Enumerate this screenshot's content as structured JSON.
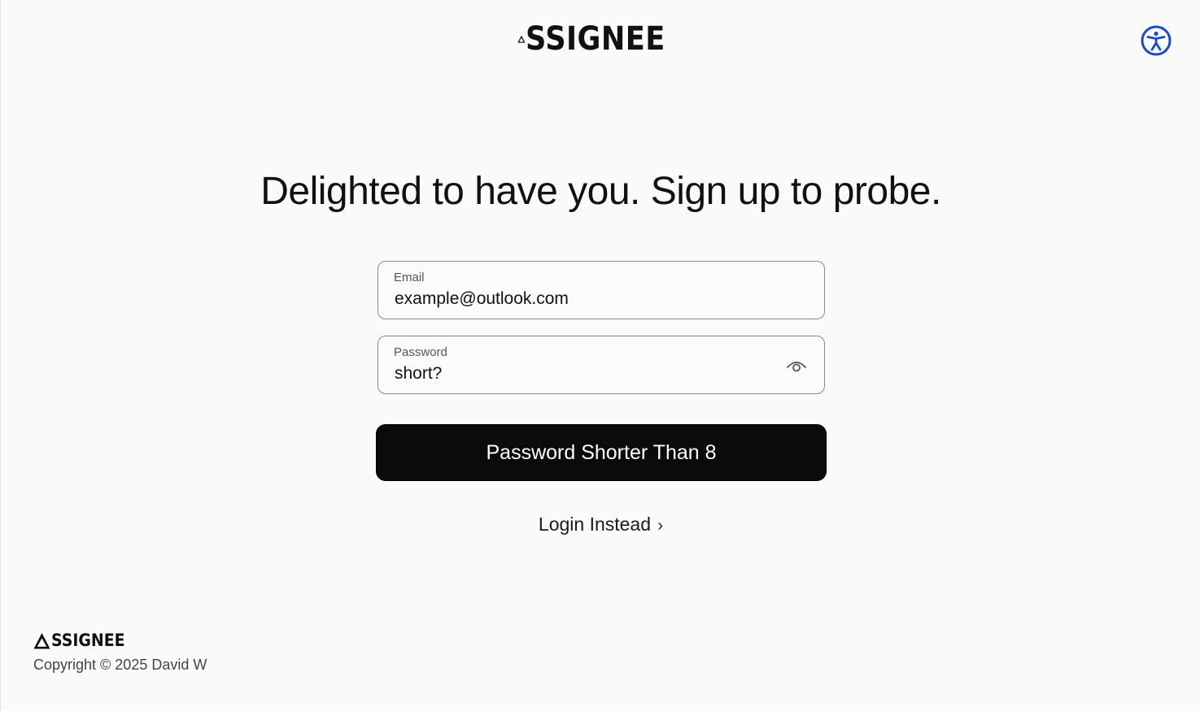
{
  "brand": {
    "name": "SSIGNEE"
  },
  "heading": "Delighted to have you. Sign up to probe.",
  "form": {
    "email": {
      "label": "Email",
      "value": "example@outlook.com"
    },
    "password": {
      "label": "Password",
      "value": "short?"
    },
    "submit_label": "Password Shorter Than 8"
  },
  "login_link": {
    "label": "Login Instead",
    "chevron": "›"
  },
  "footer": {
    "brand_name": "SSIGNEE",
    "copyright": "Copyright © 2025 David W"
  },
  "icons": {
    "logo": "triangle-a-logo-icon",
    "accessibility": "accessibility-icon",
    "password_toggle": "eye-icon"
  },
  "colors": {
    "background": "#fafafa",
    "button_bg": "#0b0b0b",
    "button_text": "#ffffff",
    "accessibility_blue": "#1b49c9",
    "field_border": "#8a8a8a"
  }
}
